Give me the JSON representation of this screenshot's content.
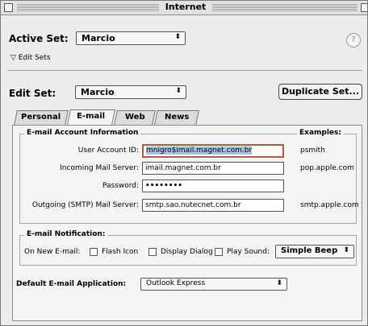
{
  "window": {
    "title": "Internet"
  },
  "active_set": {
    "label": "Active Set:",
    "value": "Marcio"
  },
  "help": {
    "glyph": "?"
  },
  "edit_sets": {
    "label": "Edit Sets",
    "triangle": "▽"
  },
  "edit_set": {
    "label": "Edit Set:",
    "value": "Marcio",
    "duplicate_label": "Duplicate Set..."
  },
  "tabs": [
    {
      "label": "Personal"
    },
    {
      "label": "E-mail"
    },
    {
      "label": "Web"
    },
    {
      "label": "News"
    }
  ],
  "email_account": {
    "title": "E-mail Account Information",
    "examples_title": "Examples:",
    "fields": [
      {
        "label": "User Account ID:",
        "value": "mnigro$imail.magnet.com.br",
        "example": "psmith"
      },
      {
        "label": "Incoming Mail Server:",
        "value": "imail.magnet.com.br",
        "example": "pop.apple.com"
      },
      {
        "label": "Password:",
        "value": "••••••••",
        "example": ""
      },
      {
        "label": "Outgoing (SMTP) Mail Server:",
        "value": "smtp.sao.nutecnet.com.br",
        "example": "smtp.apple.com"
      }
    ]
  },
  "notification": {
    "title": "E-mail Notification:",
    "on_new_label": "On New E-mail:",
    "options": [
      {
        "label": "Flash Icon",
        "checked": false
      },
      {
        "label": "Display Dialog",
        "checked": false
      },
      {
        "label": "Play Sound:",
        "checked": false
      }
    ],
    "sound": "Simple Beep"
  },
  "default_app": {
    "label": "Default E-mail Application:",
    "value": "Outlook Express"
  },
  "popup_arrows": "⬍"
}
